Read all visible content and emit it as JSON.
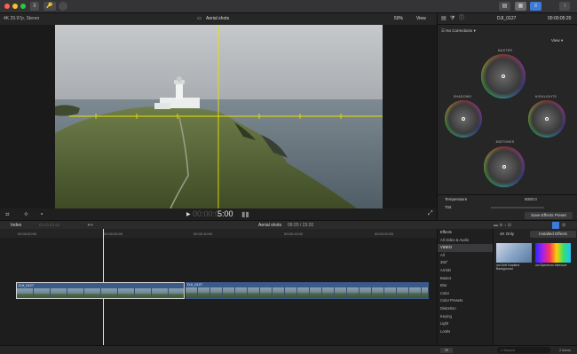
{
  "app": {
    "title_buttons": [
      "⇩",
      "🔑"
    ],
    "right_buttons": [
      "▤",
      "▦",
      "≡"
    ]
  },
  "viewer": {
    "format": "4K 29.97p, Stereo",
    "clip_name": "Aerial shots",
    "zoom": "50%",
    "view_label": "View"
  },
  "transport": {
    "timecode_dim": "00:00:0",
    "timecode_bright": "5:00"
  },
  "inspector": {
    "clip_name": "DJI_0127",
    "duration": "00:00:05:20",
    "corrections_label": "No Corrections",
    "view_label": "View",
    "wheels": [
      "MASTER",
      "SHADOWS",
      "HIGHLIGHTS",
      "MIDTONES"
    ],
    "params": [
      {
        "label": "Temperature",
        "value": "5000.0"
      },
      {
        "label": "Tint",
        "value": "0"
      }
    ],
    "save_preset": "Save Effects Preset"
  },
  "timeline_header": {
    "index_label": "Index",
    "project_name": "Aerial shots",
    "timecode": "09:20 / 23:20"
  },
  "ruler": [
    "00:00:00:00",
    "00:00:05:00",
    "00:00:10:00",
    "00:00:15:00",
    "00:00:20:00"
  ],
  "clips": [
    {
      "name": "DJI_0127"
    },
    {
      "name": "DJI_0127"
    }
  ],
  "effects": {
    "header": "Effects",
    "filter_4k": "4K Only",
    "installed": "Installed Effects",
    "categories": [
      "All Video & Audio",
      "VIDEO",
      "All",
      "360°",
      "Arri4D",
      "Basics",
      "Blur",
      "Color",
      "Color Presets",
      "Distortion",
      "Keying",
      "Light",
      "Looks"
    ],
    "thumbs": [
      {
        "name": "uni.Soft Gradient Background"
      },
      {
        "name": "uni.Spectrum Intensive"
      }
    ],
    "search_placeholder": "Search",
    "count": "2 items"
  },
  "colors": {
    "selection_outline": "#d8d8d8",
    "clip_bar": "#3a5a8a",
    "playhead": "#e0e0e0",
    "guide_lines": "#e8e000",
    "highlight_blue": "#3d7bd9"
  }
}
